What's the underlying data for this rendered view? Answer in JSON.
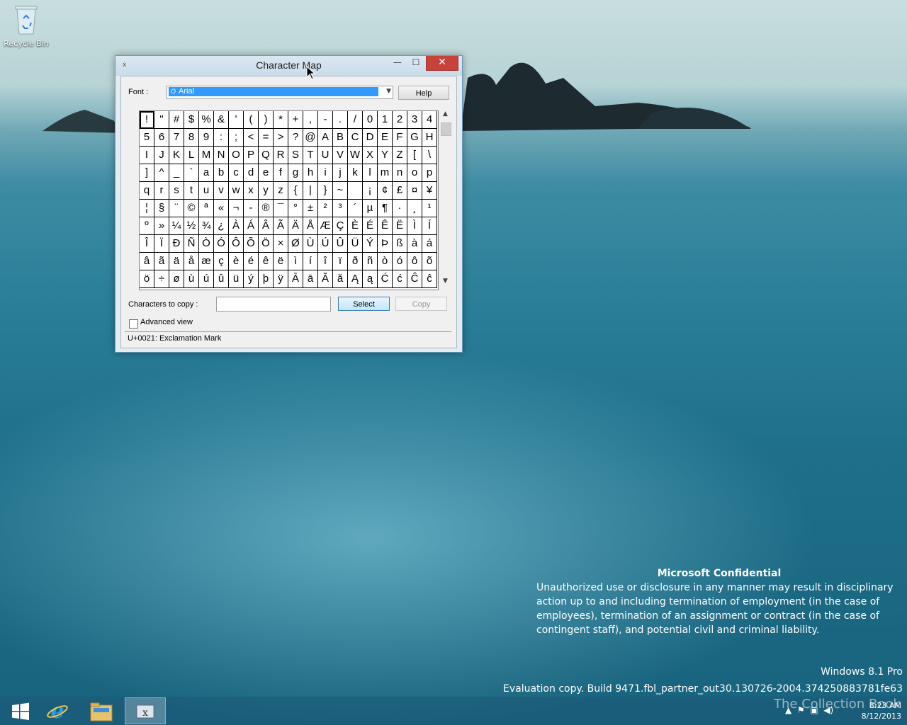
{
  "desktop": {
    "recycle_bin_label": "Recycle Bin"
  },
  "window": {
    "title": "Character Map",
    "font_label": "Font :",
    "font_value": "Arial",
    "help_label": "Help",
    "characters": [
      "!",
      "\"",
      "#",
      "$",
      "%",
      "&",
      "'",
      "(",
      ")",
      "*",
      "+",
      ",",
      "-",
      ".",
      "/",
      "0",
      "1",
      "2",
      "3",
      "4",
      "5",
      "6",
      "7",
      "8",
      "9",
      ":",
      ";",
      "<",
      "=",
      ">",
      "?",
      "@",
      "A",
      "B",
      "C",
      "D",
      "E",
      "F",
      "G",
      "H",
      "I",
      "J",
      "K",
      "L",
      "M",
      "N",
      "O",
      "P",
      "Q",
      "R",
      "S",
      "T",
      "U",
      "V",
      "W",
      "X",
      "Y",
      "Z",
      "[",
      "\\",
      "]",
      "^",
      "_",
      "`",
      "a",
      "b",
      "c",
      "d",
      "e",
      "f",
      "g",
      "h",
      "i",
      "j",
      "k",
      "l",
      "m",
      "n",
      "o",
      "p",
      "q",
      "r",
      "s",
      "t",
      "u",
      "v",
      "w",
      "x",
      "y",
      "z",
      "{",
      "|",
      "}",
      "~",
      " ",
      "¡",
      "¢",
      "£",
      "¤",
      "¥",
      "¦",
      "§",
      "¨",
      "©",
      "ª",
      "«",
      "¬",
      "-",
      "®",
      "¯",
      "°",
      "±",
      "²",
      "³",
      "´",
      "µ",
      "¶",
      "·",
      "¸",
      "¹",
      "º",
      "»",
      "¼",
      "½",
      "¾",
      "¿",
      "À",
      "Á",
      "Â",
      "Ã",
      "Ä",
      "Å",
      "Æ",
      "Ç",
      "È",
      "É",
      "Ê",
      "Ë",
      "Ì",
      "Í",
      "Î",
      "Ï",
      "Ð",
      "Ñ",
      "Ò",
      "Ó",
      "Ô",
      "Õ",
      "Ö",
      "×",
      "Ø",
      "Ù",
      "Ú",
      "Û",
      "Ü",
      "Ý",
      "Þ",
      "ß",
      "à",
      "á",
      "â",
      "ã",
      "ä",
      "å",
      "æ",
      "ç",
      "è",
      "é",
      "ê",
      "ë",
      "ì",
      "í",
      "î",
      "ï",
      "ð",
      "ñ",
      "ò",
      "ó",
      "ô",
      "õ",
      "ö",
      "÷",
      "ø",
      "ù",
      "ú",
      "û",
      "ü",
      "ý",
      "þ",
      "ÿ",
      "Ā",
      "ā",
      "Ă",
      "ă",
      "Ą",
      "ą",
      "Ć",
      "ć",
      "Ĉ",
      "ĉ"
    ],
    "selected_index": 0,
    "chars_to_copy_label": "Characters to copy :",
    "chars_to_copy_value": "",
    "select_label": "Select",
    "copy_label": "Copy",
    "advanced_view_label": "Advanced view",
    "advanced_view_checked": false,
    "status_text": "U+0021: Exclamation Mark"
  },
  "watermark": {
    "heading": "Microsoft Confidential",
    "body": "Unauthorized use or disclosure in any manner may result in disciplinary action up to and including termination of employment (in the case of employees), termination of an assignment or contract (in the case of contingent staff), and potential civil and criminal liability.",
    "edition": "Windows 8.1 Pro",
    "build": "Evaluation copy. Build 9471.fbl_partner_out30.130726-2004.374250883781fe63"
  },
  "taskbar": {
    "overlay_text": "The Collection Book",
    "time": "8:23 AM",
    "date": "8/12/2013"
  },
  "colors": {
    "close_button": "#c7423a",
    "selection": "#3399ff",
    "title_bar": "#d6e5f0"
  }
}
